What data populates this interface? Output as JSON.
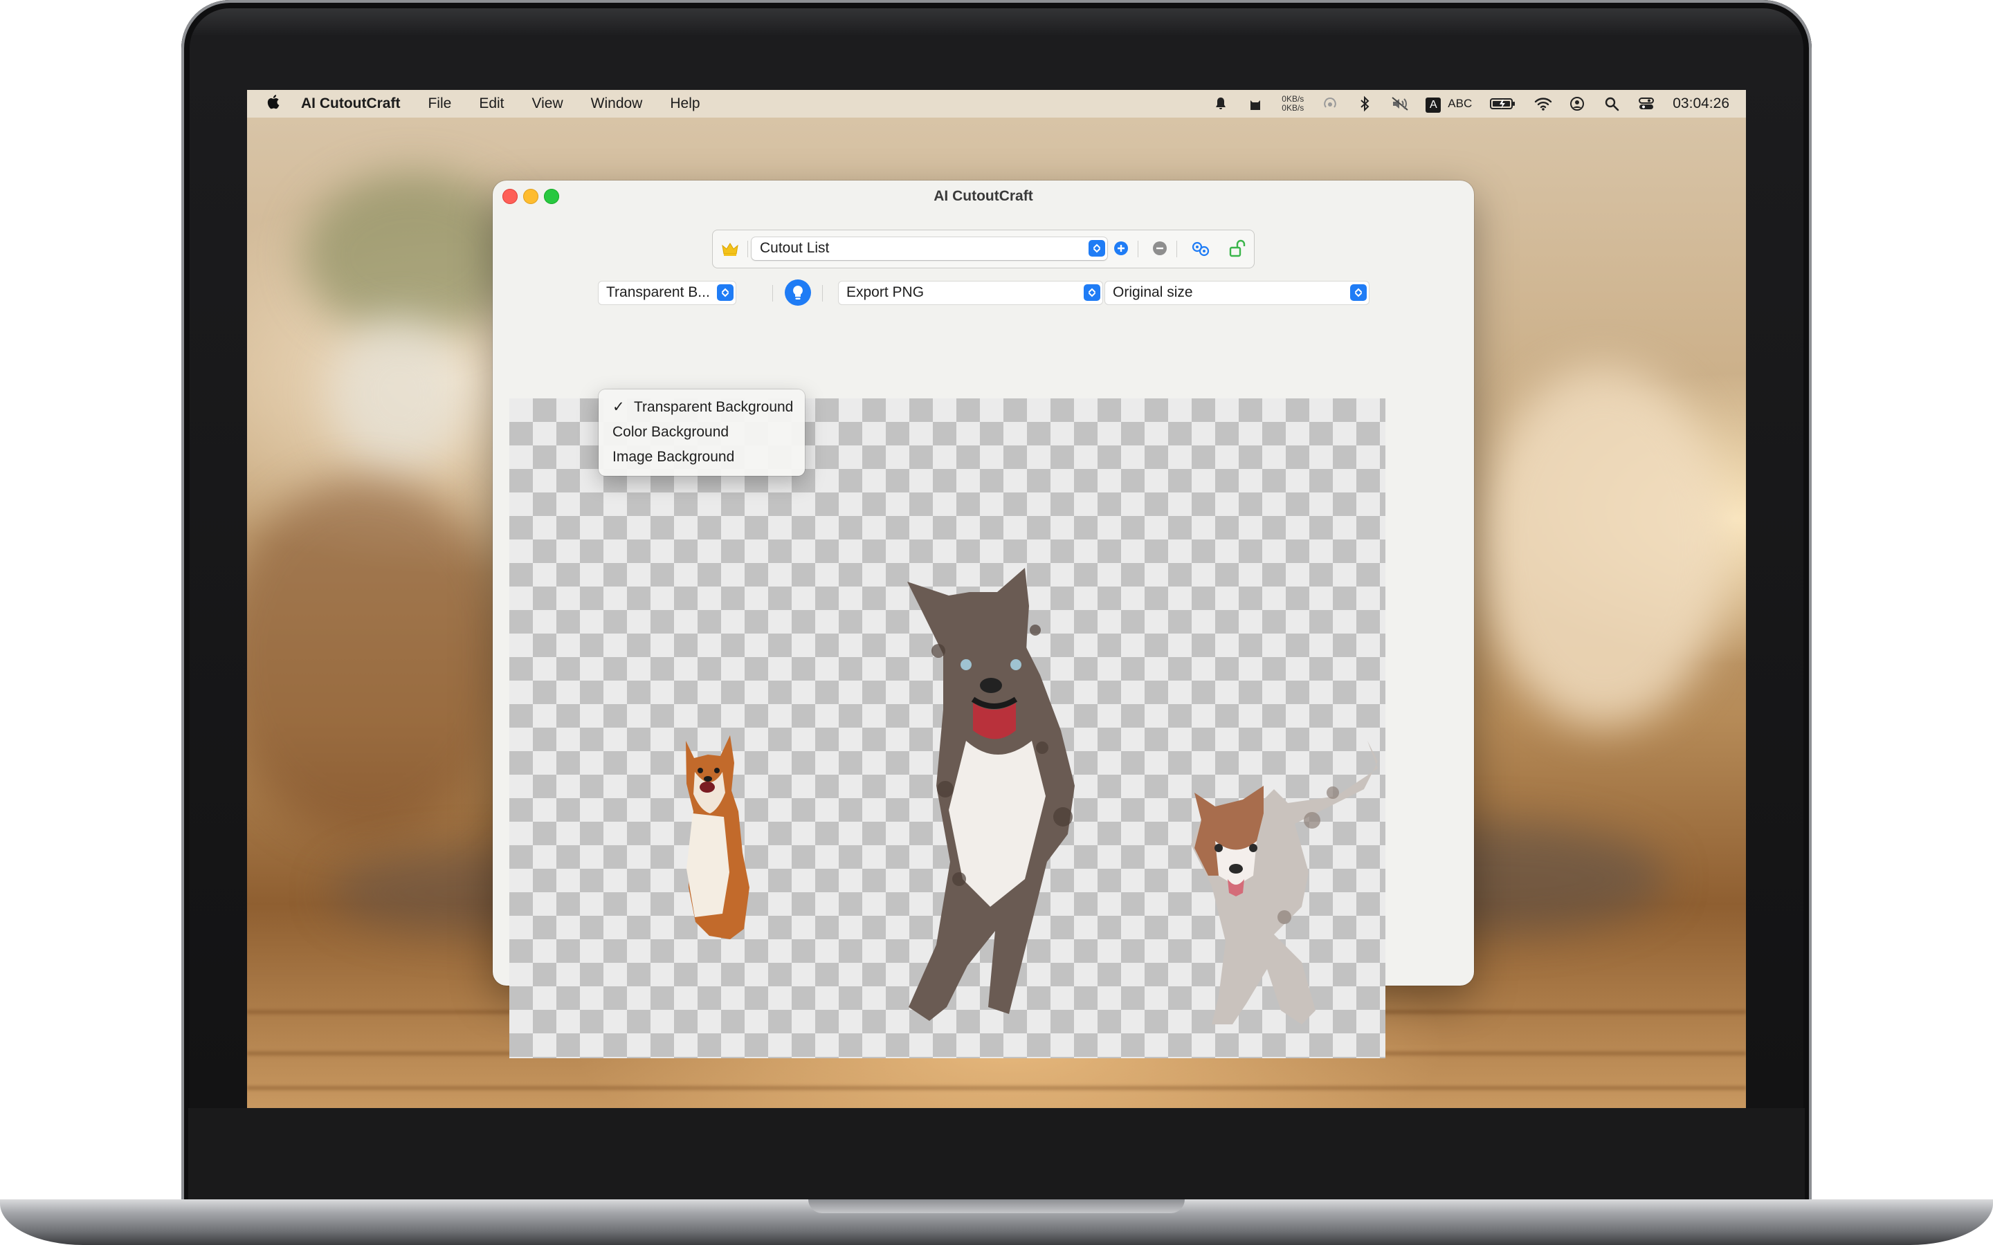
{
  "menubar": {
    "app_name": "AI CutoutCraft",
    "items": [
      "File",
      "Edit",
      "View",
      "Window",
      "Help"
    ],
    "net_up": "0KB/s",
    "net_down": "0KB/s",
    "input_source": "A",
    "input_label": "ABC",
    "clock": "03:04:26"
  },
  "window": {
    "title": "AI CutoutCraft",
    "cutout_list": {
      "selected": "Cutout List"
    },
    "background_mode": {
      "selected": "Transparent B..."
    },
    "export_format": {
      "selected": "Export PNG"
    },
    "export_size": {
      "selected": "Original size"
    },
    "background_menu": {
      "items": [
        {
          "label": "Transparent Background",
          "checked": true,
          "check_mark": "✓"
        },
        {
          "label": "Color Background",
          "checked": false
        },
        {
          "label": "Image Background",
          "checked": false
        }
      ]
    },
    "canvas": {
      "subjects": [
        "corgi",
        "australian shepherd dog",
        "australian shepherd puppy"
      ]
    }
  },
  "colors": {
    "accent": "#1f7cf5",
    "close": "#fe5f57",
    "minimize": "#febc2e",
    "maximize": "#28c840",
    "crown": "#f3c21b",
    "lock": "#3ab54a"
  }
}
